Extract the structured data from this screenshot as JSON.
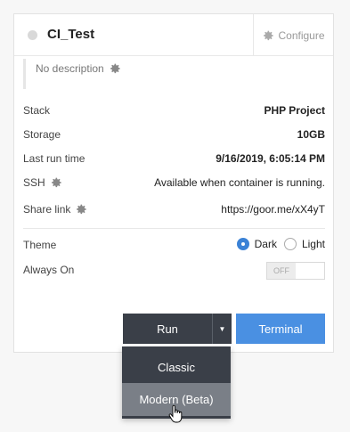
{
  "project": {
    "name": "CI_Test",
    "configure_label": "Configure",
    "description": "No description"
  },
  "details": {
    "stack_label": "Stack",
    "stack_value": "PHP Project",
    "storage_label": "Storage",
    "storage_value": "10GB",
    "last_run_label": "Last run time",
    "last_run_value": "9/16/2019, 6:05:14 PM",
    "ssh_label": "SSH",
    "ssh_value": "Available when container is running.",
    "share_label": "Share link",
    "share_value": "https://goor.me/xX4yT"
  },
  "settings": {
    "theme_label": "Theme",
    "theme_dark": "Dark",
    "theme_light": "Light",
    "theme_selected": "Dark",
    "always_on_label": "Always On",
    "always_on_state": "OFF"
  },
  "actions": {
    "run_label": "Run",
    "terminal_label": "Terminal"
  },
  "run_menu": {
    "items": [
      "Classic",
      "Modern (Beta)"
    ],
    "hovered": "Modern (Beta)"
  },
  "colors": {
    "accent": "#4a90e2",
    "dark_button": "#3a3f48",
    "radio_selected": "#3b82d6"
  },
  "icons": {
    "settings": "gear-icon",
    "status": "status-dot",
    "cursor": "hand-pointer-icon",
    "caret": "caret-down-icon"
  }
}
